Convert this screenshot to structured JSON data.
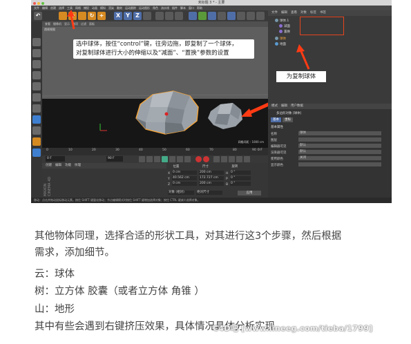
{
  "window": {
    "title": "未标题 3 * - 主要",
    "menu": [
      "文件",
      "编辑",
      "创建",
      "选择",
      "工具",
      "网格",
      "捕捉",
      "动画",
      "模拟",
      "渲染",
      "雕刻",
      "运动跟踪",
      "运动图形",
      "角色",
      "流水线",
      "插件",
      "脚本",
      "窗口",
      "帮助"
    ]
  },
  "toolbar": {
    "axis_x": "X",
    "axis_y": "Y",
    "axis_z": "Z"
  },
  "viewport": {
    "menu": [
      "查看",
      "摄像机",
      "显示",
      "选项",
      "过滤",
      "面板"
    ],
    "name": "透视视图",
    "grid_scale": "网格间距 : 1000 cm"
  },
  "annotations": {
    "note1_line1": "选中球体，按住“control”键，往旁边拖，即复制了一个球体，",
    "note1_line2": "对复制球体进行大小的伸缩以及“减面”、“置换”参数的设置",
    "note2": "为复制球体"
  },
  "timeline": {
    "ticks": [
      "0",
      "10",
      "20",
      "30",
      "40",
      "50",
      "60",
      "70",
      "80",
      "90"
    ],
    "end_frame": "0 F",
    "start_field": "0 F",
    "end_field": "90 F"
  },
  "material": {
    "menu": [
      "创建",
      "编辑",
      "功能",
      "纹理"
    ],
    "logo": "MAXON CINEMA 4D"
  },
  "coordinates": {
    "headers": [
      "位置",
      "尺寸",
      "旋转"
    ],
    "rows": [
      {
        "axis": "X",
        "pos": "0 cm",
        "size": "200 cm",
        "rot_axis": "H",
        "rot": "0 °"
      },
      {
        "axis": "Y",
        "pos": "40.562 cm",
        "size": "172.727 cm",
        "rot_axis": "P",
        "rot": "0 °"
      },
      {
        "axis": "Z",
        "pos": "0 cm",
        "size": "200 cm",
        "rot_axis": "B",
        "rot": "0 °"
      }
    ],
    "mode": "对象 (相对)",
    "size_mode": "绝对尺寸",
    "apply": "应用"
  },
  "objects": {
    "menu": [
      "文件",
      "编辑",
      "查看",
      "对象",
      "标签",
      "书签"
    ],
    "items": [
      "球体.1",
      "减面",
      "置换",
      "球体",
      "地面"
    ]
  },
  "attributes": {
    "menu": [
      "模式",
      "编辑",
      "用户数据"
    ],
    "type": "多边形对象 [球体]",
    "tabs": [
      "基本",
      "坐标"
    ],
    "section": "基本属性",
    "fields": [
      {
        "label": "名称",
        "value": "球体"
      },
      {
        "label": "图层",
        "value": ""
      },
      {
        "label": "编辑器可见",
        "value": "默认"
      },
      {
        "label": "渲染器可见",
        "value": "默认"
      },
      {
        "label": "使用颜色",
        "value": "关闭"
      },
      {
        "label": "显示颜色",
        "value": ""
      }
    ]
  },
  "statusbar": "移动：点击并拖动鼠标移动元素。按住 SHIFT 键量化移动；节点编辑模式时按住 SHIFT 键增加选择对象；按住 CTRL 键减少选择对象。",
  "caption": {
    "line1": "其他物体同理，选择合适的形状工具，对其进行这3个步骤，然后根据",
    "line2": "需求，添加细节。",
    "line3": "云：球体",
    "line4": "树：立方体 胶囊（或者立方体   角锥 ）",
    "line5": "山：地形",
    "line6": "其中有些会遇到右键挤压效果，具体情况具体分析实现"
  },
  "watermark": "C4D吧 [www.lineeg.com/tieba/1799]"
}
